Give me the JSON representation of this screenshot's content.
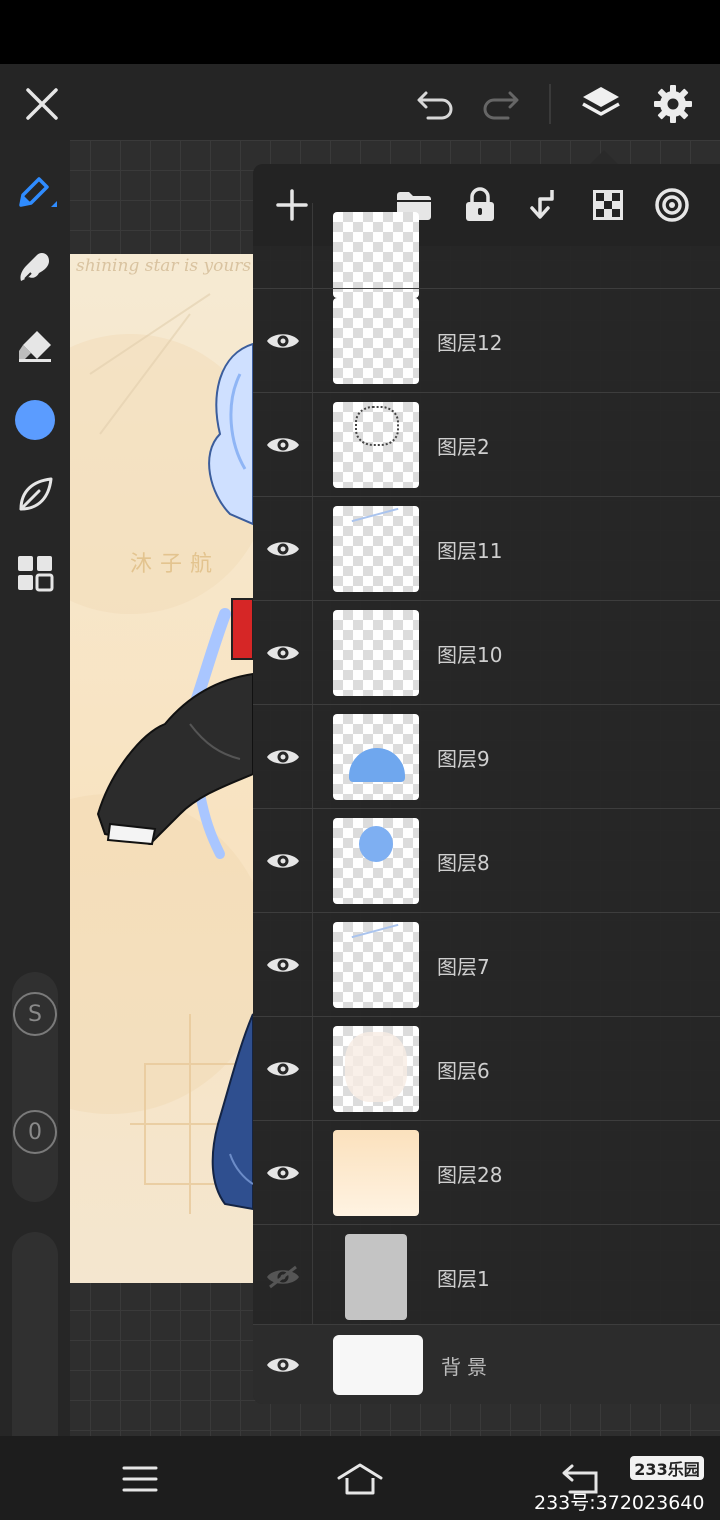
{
  "layers_panel": {
    "layers": [
      {
        "name": "",
        "visible": true,
        "thumb": "partial"
      },
      {
        "name": "图层12",
        "visible": true,
        "thumb": "empty"
      },
      {
        "name": "图层2",
        "visible": true,
        "thumb": "lineart"
      },
      {
        "name": "图层11",
        "visible": true,
        "thumb": "sketch"
      },
      {
        "name": "图层10",
        "visible": true,
        "thumb": "empty"
      },
      {
        "name": "图层9",
        "visible": true,
        "thumb": "blue-hair"
      },
      {
        "name": "图层8",
        "visible": true,
        "thumb": "blue-head"
      },
      {
        "name": "图层7",
        "visible": true,
        "thumb": "sketch"
      },
      {
        "name": "图层6",
        "visible": true,
        "thumb": "light"
      },
      {
        "name": "图层28",
        "visible": true,
        "thumb": "cream"
      },
      {
        "name": "图层1",
        "visible": false,
        "thumb": "grey"
      }
    ],
    "background_label": "背景"
  },
  "left_toolbar": {
    "color": "#5b9cff",
    "size_label": "S",
    "opacity_label": "0"
  },
  "artwork": {
    "watermark_text": "沐子航",
    "script_text": "shining star is yours"
  },
  "watermark": {
    "badge": "233乐园",
    "id_text": "233号:372023640"
  },
  "colors": {
    "accent": "#2f8cff"
  }
}
